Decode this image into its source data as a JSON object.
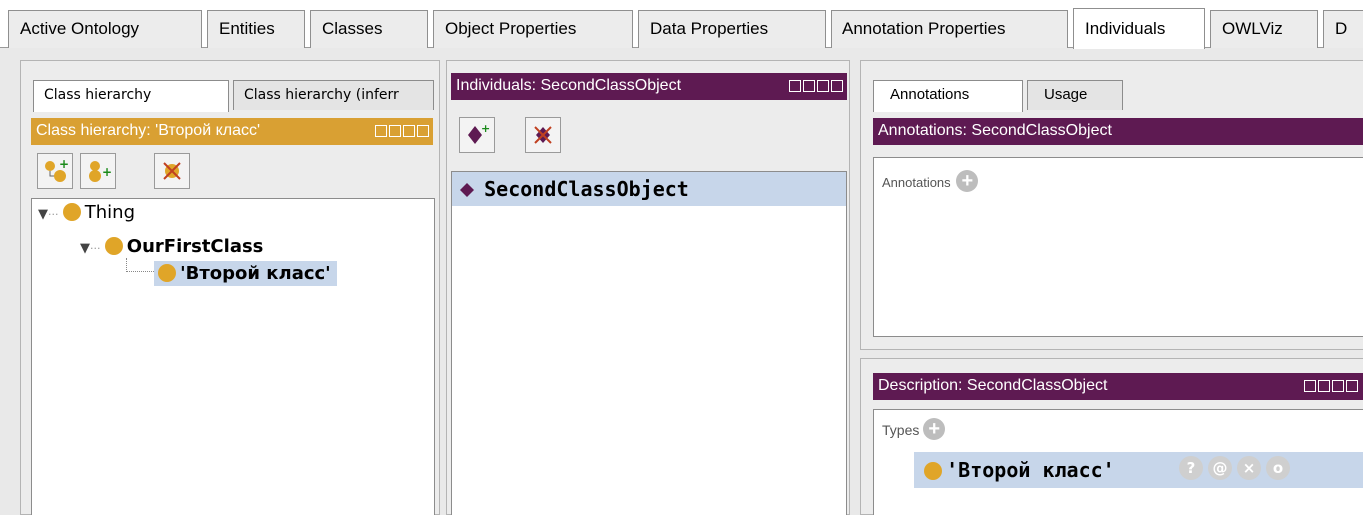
{
  "tabs": [
    "Active Ontology",
    "Entities",
    "Classes",
    "Object Properties",
    "Data Properties",
    "Annotation Properties",
    "Individuals",
    "OWLViz",
    "D"
  ],
  "left": {
    "subtabs": [
      "Class hierarchy",
      "Class hierarchy (inferr"
    ],
    "header": "Class hierarchy: 'Второй класс'",
    "tree": {
      "root": "Thing",
      "child": "OurFirstClass",
      "grandchild": "'Второй класс'"
    }
  },
  "middle": {
    "header": "Individuals: SecondClassObject",
    "items": [
      "SecondClassObject"
    ]
  },
  "right": {
    "subtabs": [
      "Annotations",
      "Usage"
    ],
    "annotations_header": "Annotations: SecondClassObject",
    "annotations_label": "Annotations",
    "description_header": "Description: SecondClassObject",
    "types_label": "Types",
    "type_value": "'Второй класс'"
  },
  "colors": {
    "gold_header": "#d9a033",
    "purple_header": "#5e1a52",
    "selection": "#c7d6ea",
    "class_dot": "#e0a528"
  },
  "icons": [
    "add-subclass-icon",
    "add-sibling-class-icon",
    "delete-class-icon",
    "add-individual-icon",
    "delete-individual-icon",
    "individual-diamond-icon",
    "add-annotation-icon",
    "add-type-icon",
    "explain-icon",
    "annotate-icon",
    "remove-icon",
    "edit-icon"
  ]
}
